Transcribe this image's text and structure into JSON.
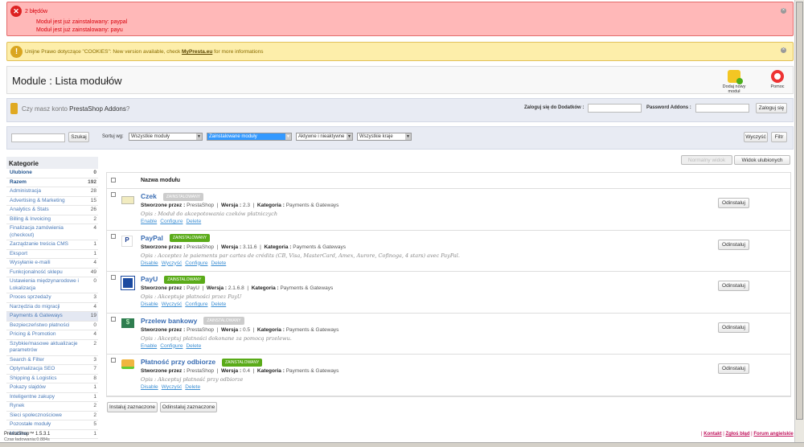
{
  "errors": {
    "title": "2 błędów",
    "items": [
      "Moduł jest już zainstalowany: paypal",
      "Moduł jest już zainstalowany: payu"
    ]
  },
  "warning": {
    "text": "Unijne Prawo dotyczące \"COOKIES\": New version available, check ",
    "link": "MyPresta.eu",
    "suffix": " for more informations"
  },
  "page_title": "Module : Lista modułów",
  "toolbar": {
    "add": "Dodaj nowy moduł",
    "help": "Pomoc"
  },
  "addons": {
    "question": "Czy masz konto ",
    "brand": "PrestaShop Addons",
    "q": "?",
    "login_label": "Zaloguj się do Dodatków :",
    "password_label": "Password Addons :",
    "login_button": "Zaloguj się"
  },
  "filters": {
    "search_button": "Szukaj",
    "sort_label": "Sortuj wg:",
    "sel1": "Wszystkie moduły",
    "sel2": "Zainstalowane moduły",
    "sel3": "Aktywne i nieaktywne",
    "sel4": "Wszystkie kraje",
    "clear": "Wyczyść",
    "filter": "Filtr"
  },
  "views": {
    "normal": "Normalny widok",
    "fav": "Widok ulubionych"
  },
  "sidebar": {
    "title": "Kategorie",
    "items": [
      {
        "label": "Ulubione",
        "count": "0"
      },
      {
        "label": "Razem",
        "count": "192"
      },
      {
        "label": "Administracja",
        "count": "28"
      },
      {
        "label": "Advertising & Marketing",
        "count": "15"
      },
      {
        "label": "Analytics & Stats",
        "count": "26"
      },
      {
        "label": "Billing & Invoicing",
        "count": "2"
      },
      {
        "label": "Finalizacja zamówienia (checkout)",
        "count": "4"
      },
      {
        "label": "Zarządzanie treścia CMS",
        "count": "1"
      },
      {
        "label": "Eksport",
        "count": "1"
      },
      {
        "label": "Wysyłanie e-maili",
        "count": "4"
      },
      {
        "label": "Funkcjonalność sklepu",
        "count": "49"
      },
      {
        "label": "Ustawienia międzynarodowe i Lokalizacja",
        "count": "0"
      },
      {
        "label": "Proces sprzedaży",
        "count": "3"
      },
      {
        "label": "Narzędzia do migracji",
        "count": "4"
      },
      {
        "label": "Payments & Gateways",
        "count": "19"
      },
      {
        "label": "Bezpieczeństwo płatności",
        "count": "0"
      },
      {
        "label": "Pricing & Promotion",
        "count": "4"
      },
      {
        "label": "Szybkie/masowe aktualizacje parametrów",
        "count": "2"
      },
      {
        "label": "Search & Filter",
        "count": "3"
      },
      {
        "label": "Optymalizacja SEO",
        "count": "7"
      },
      {
        "label": "Shipping & Logistics",
        "count": "8"
      },
      {
        "label": "Pokazy slajdów",
        "count": "1"
      },
      {
        "label": "Inteligentne zakupy",
        "count": "1"
      },
      {
        "label": "Rynek",
        "count": "2"
      },
      {
        "label": "Sieci społecznościowe",
        "count": "2"
      },
      {
        "label": "Pozostałe moduły",
        "count": "5"
      },
      {
        "label": "Mobilne",
        "count": "1"
      }
    ]
  },
  "list": {
    "header": "Nazwa modułu",
    "labels": {
      "by": "Stworzone przez :",
      "ver": "Wersja :",
      "cat": "Kategoria :",
      "desc": "Opis :"
    },
    "uninstall": "Odinstaluj",
    "modules": [
      {
        "name": "Czek",
        "badge": "ZAINSTALOWANY",
        "active": false,
        "author": "PrestaShop",
        "version": "2.3",
        "category": "Payments & Gateways",
        "desc": "Moduł do akcepotowania czeków płatniczych",
        "actions": [
          "Enable",
          "Configure",
          "Delete"
        ]
      },
      {
        "name": "PayPal",
        "badge": "ZAINSTALOWANY",
        "active": true,
        "author": "PrestaShop",
        "version": "3.11.6",
        "category": "Payments & Gateways",
        "desc": "Acceptez le paiements par cartes de crédits (CB, Visa, MasterCard, Amex, Aurore, Cofinoga, 4 stars) avec PayPal.",
        "actions": [
          "Disable",
          "Wyczyść",
          "Configure",
          "Delete"
        ]
      },
      {
        "name": "PayU",
        "badge": "ZAINSTALOWANY",
        "active": true,
        "author": "PayU",
        "version": "2.1.6.8",
        "category": "Payments & Gateways",
        "desc": "Akceptuje płatności przez PayU",
        "actions": [
          "Disable",
          "Wyczyść",
          "Configure",
          "Delete"
        ]
      },
      {
        "name": "Przelew bankowy",
        "badge": "ZAINSTALOWANY",
        "active": false,
        "author": "PrestaShop",
        "version": "0.5",
        "category": "Payments & Gateways",
        "desc": "Akceptuj płatności dokonane za pomocą przelewu.",
        "actions": [
          "Enable",
          "Configure",
          "Delete"
        ]
      },
      {
        "name": "Płatność przy odbiorze",
        "badge": "ZAINSTALOWANY",
        "active": true,
        "author": "PrestaShop",
        "version": "0.4",
        "category": "Payments & Gateways",
        "desc": "Akceptuj płatność przy odbiorze",
        "actions": [
          "Disable",
          "Wyczyść",
          "Delete"
        ]
      }
    ]
  },
  "bulk": {
    "install": "Instaluj zaznaczone",
    "uninstall": "Odinstaluj zaznaczone"
  },
  "footer": {
    "version": "PrestaShop™ 1.5.3.1",
    "load": "Czas ładowania:0.884s",
    "links": [
      "Kontakt",
      "Zgłoś błąd",
      "Forum angielskie"
    ]
  }
}
